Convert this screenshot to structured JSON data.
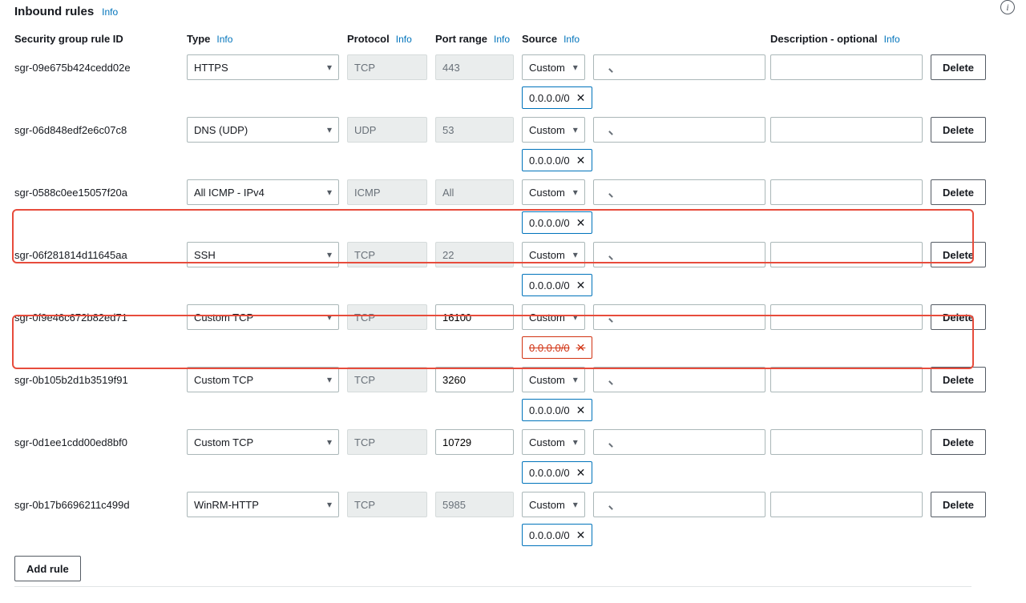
{
  "title": "Inbound rules",
  "info_label": "Info",
  "columns": {
    "rule_id": "Security group rule ID",
    "type": "Type",
    "protocol": "Protocol",
    "port_range": "Port range",
    "source": "Source",
    "description": "Description - optional"
  },
  "buttons": {
    "delete": "Delete",
    "add_rule": "Add rule"
  },
  "source_default": "Custom",
  "rules": [
    {
      "id": "sgr-09e675b424cedd02e",
      "type": "HTTPS",
      "protocol": "TCP",
      "port": "443",
      "port_editable": false,
      "source": "Custom",
      "cidr": "0.0.0.0/0",
      "highlight": false,
      "cidr_struck": false
    },
    {
      "id": "sgr-06d848edf2e6c07c8",
      "type": "DNS (UDP)",
      "protocol": "UDP",
      "port": "53",
      "port_editable": false,
      "source": "Custom",
      "cidr": "0.0.0.0/0",
      "highlight": false,
      "cidr_struck": false
    },
    {
      "id": "sgr-0588c0ee15057f20a",
      "type": "All ICMP - IPv4",
      "protocol": "ICMP",
      "port": "All",
      "port_editable": false,
      "source": "Custom",
      "cidr": "0.0.0.0/0",
      "highlight": false,
      "cidr_struck": false
    },
    {
      "id": "sgr-06f281814d11645aa",
      "type": "SSH",
      "protocol": "TCP",
      "port": "22",
      "port_editable": false,
      "source": "Custom",
      "cidr": "0.0.0.0/0",
      "highlight": true,
      "cidr_struck": false
    },
    {
      "id": "sgr-0f9e46c672b82ed71",
      "type": "Custom TCP",
      "protocol": "TCP",
      "port": "16100",
      "port_editable": true,
      "source": "Custom",
      "cidr": "0.0.0.0/0",
      "highlight": false,
      "cidr_struck": true
    },
    {
      "id": "sgr-0b105b2d1b3519f91",
      "type": "Custom TCP",
      "protocol": "TCP",
      "port": "3260",
      "port_editable": true,
      "source": "Custom",
      "cidr": "0.0.0.0/0",
      "highlight": true,
      "cidr_struck": false
    },
    {
      "id": "sgr-0d1ee1cdd00ed8bf0",
      "type": "Custom TCP",
      "protocol": "TCP",
      "port": "10729",
      "port_editable": true,
      "source": "Custom",
      "cidr": "0.0.0.0/0",
      "highlight": false,
      "cidr_struck": false
    },
    {
      "id": "sgr-0b17b6696211c499d",
      "type": "WinRM-HTTP",
      "protocol": "TCP",
      "port": "5985",
      "port_editable": false,
      "source": "Custom",
      "cidr": "0.0.0.0/0",
      "highlight": false,
      "cidr_struck": false
    }
  ]
}
